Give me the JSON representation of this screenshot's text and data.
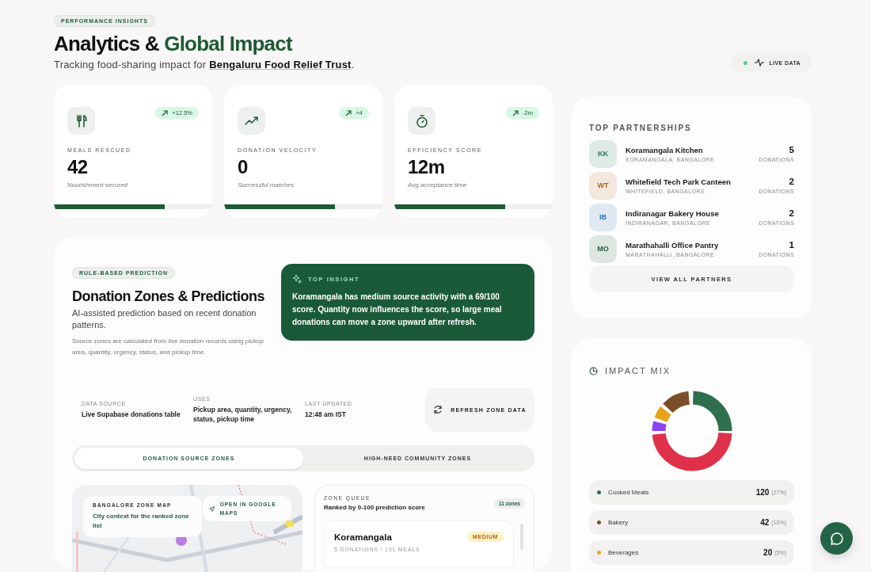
{
  "header": {
    "badge": "PERFORMANCE INSIGHTS",
    "title": "Analytics & ",
    "title_accent": "Global Impact",
    "subtitle": "Tracking food-sharing impact for ",
    "organization": "Bengaluru Food Relief Trust",
    "subtitle_end": ".",
    "live": {
      "label": "LIVE DATA",
      "on": true
    }
  },
  "stats": [
    {
      "kind": "meals",
      "trend": "+12.5%",
      "label": "MEALS RESCUED",
      "value": "42",
      "caption": "Nourishment secured",
      "level": 0.7
    },
    {
      "kind": "velocity",
      "trend": "+4",
      "label": "DONATION VELOCITY",
      "value": "0",
      "caption": "Successful matches",
      "level": 0.7
    },
    {
      "kind": "timer",
      "trend": "-2m",
      "label": "EFFICIENCY SCORE",
      "value": "12m",
      "caption": "Avg acceptance time",
      "level": 0.7
    }
  ],
  "predictions": {
    "badge": "RULE-BASED PREDICTION",
    "title": "Donation Zones & Predictions",
    "subtitle": "AI-assisted prediction based on recent donation patterns.",
    "description": "Source zones are calculated from live donation records using pickup area, quantity, urgency, status, and pickup time.",
    "insight": {
      "label": "TOP INSIGHT",
      "text": "Koramangala has medium source activity with a 69/100 score. Quantity now influences the score, so large meal donations can move a zone upward after refresh."
    },
    "meta": [
      {
        "label": "DATA SOURCE",
        "value": "Live Supabase donations table"
      },
      {
        "label": "USES",
        "value": "Pickup area, quantity, urgency, status, pickup time"
      },
      {
        "label": "LAST UPDATED",
        "value": "12:48 am IST"
      }
    ],
    "refresh_button": "REFRESH ZONE DATA",
    "tabs": [
      {
        "label": "DONATION SOURCE ZONES",
        "selected": true
      },
      {
        "label": "HIGH-NEED COMMUNITY ZONES",
        "selected": false
      }
    ],
    "map": {
      "label": "BANGALORE ZONE MAP",
      "caption": "City context for the ranked zone list",
      "open_button": "OPEN IN GOOGLE MAPS"
    },
    "queue": {
      "label": "ZONE QUEUE",
      "subtitle": "Ranked by 0-100 prediction score",
      "count": "11 zones",
      "zones": [
        {
          "name": "Koramangala",
          "level_label": "MEDIUM",
          "details": "5 DONATIONS / 131 MEALS"
        }
      ]
    }
  },
  "partnerships": {
    "title": "TOP PARTNERSHIPS",
    "items": [
      {
        "initials": "KK",
        "color": "#1f7a4a",
        "name": "Koramangala Kitchen",
        "location": "KORAMANGALA, BANGALORE",
        "count": "5",
        "unit": "DONATIONS"
      },
      {
        "initials": "WT",
        "color": "#b0611a",
        "name": "Whitefield Tech Park Canteen",
        "location": "WHITEFIELD, BANGALORE",
        "count": "2",
        "unit": "DONATIONS"
      },
      {
        "initials": "IB",
        "color": "#2a6fa8",
        "name": "Indiranagar Bakery House",
        "location": "INDIRANAGAR, BANGALORE",
        "count": "2",
        "unit": "DONATIONS"
      },
      {
        "initials": "MO",
        "color": "#1f5c3a",
        "name": "Marathahalli Office Pantry",
        "location": "MARATHAHALLI, BANGALORE",
        "count": "1",
        "unit": "DONATIONS"
      }
    ],
    "button": "VIEW ALL PARTNERS"
  },
  "impact_mix": {
    "title": "IMPACT MIX",
    "legend": [
      {
        "color": "#2f6f4f",
        "label": "Cooked Meals",
        "value": "120",
        "percent": "(27%)"
      },
      {
        "color": "#7a4f28",
        "label": "Bakery",
        "value": "42",
        "percent": "(10%)"
      },
      {
        "color": "#e8a317",
        "label": "Beverages",
        "value": "20",
        "percent": "(5%)"
      }
    ]
  }
}
